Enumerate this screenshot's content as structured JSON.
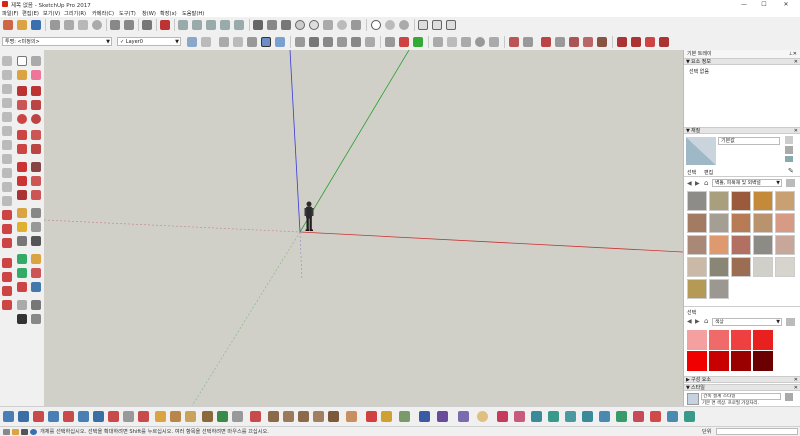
{
  "window": {
    "title": "제목 없음 - SketchUp Pro 2017",
    "minimize": "—",
    "maximize": "☐",
    "close": "✕"
  },
  "menu": [
    "파일(F)",
    "편집(E)",
    "보기(V)",
    "그리기(R)",
    "카메라(C)",
    "도구(T)",
    "창(W)",
    "확장(x)",
    "도움말(H)"
  ],
  "toolbar2": {
    "style_combo": "투명: <미정의>",
    "layer_combo": "Layer0"
  },
  "tray": {
    "title": "기본 트레이",
    "entity_info": {
      "header": "요소 정보",
      "value": "선택 없음"
    },
    "materials": {
      "header": "재질",
      "current_name": "기본값",
      "tabs": [
        "선택",
        "편집"
      ],
      "library": "벽돌, 피복재 및 외벽널"
    },
    "colors": {
      "label": "선택",
      "combo": "색상"
    },
    "components_header": "구성 요소",
    "styles_header": "스타일",
    "style_name": "건축 설계 스타일",
    "style_desc": "기본 면 색상. 프로필 가장자리."
  },
  "status": {
    "message": "개체를 선택하십시오. 선택을 확대하려면 Shift를 누르십시오. 여러 항목을 선택하려면 마우스를 끄십시오.",
    "units_label": "단위"
  }
}
